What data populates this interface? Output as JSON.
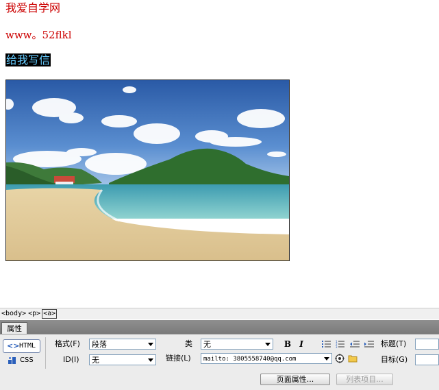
{
  "page": {
    "site_title": "我爱自学网",
    "site_url": "www。52flkl",
    "mail_link_text": "给我写信"
  },
  "tag_selector": {
    "tags": [
      "<body>",
      "<p>",
      "<a>"
    ]
  },
  "panel": {
    "tab_label": "属性",
    "html_button": "HTML",
    "css_button": "CSS",
    "format_label": "格式(F)",
    "format_value": "段落",
    "id_label": "ID(I)",
    "id_value": "无",
    "class_label": "类",
    "class_value": "无",
    "link_label": "链接(L)",
    "link_value": "mailto: 3805558740@qq.com",
    "bold_label": "B",
    "italic_label": "I",
    "title_label": "标题(T)",
    "target_label": "目标(G)",
    "page_props_button": "页面属性...",
    "list_item_button": "列表项目..."
  },
  "colors": {
    "site_text": "#cc0000",
    "link_text": "#66ccff",
    "link_bg": "#000000"
  }
}
